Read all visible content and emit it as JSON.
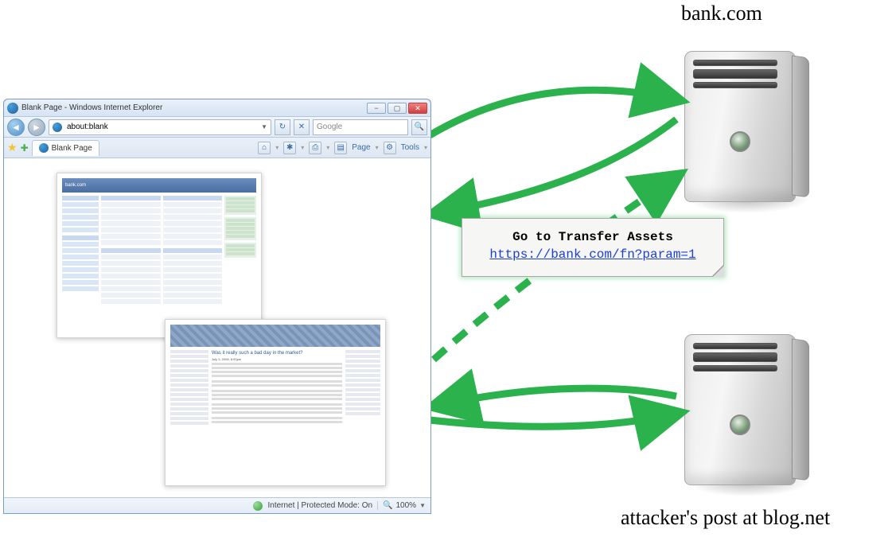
{
  "labels": {
    "bank_server": "bank.com",
    "attacker_server": "attacker's post at blog.net"
  },
  "ie": {
    "title": "Blank Page - Windows Internet Explorer",
    "url": "about:blank",
    "search_placeholder": "Google",
    "tab_name": "Blank Page",
    "toolbar": {
      "page": "Page",
      "tools": "Tools"
    },
    "status": {
      "zone": "Internet | Protected Mode: On",
      "zoom": "100%"
    }
  },
  "thumbs": {
    "bank_header": "bank.com",
    "blog_title_line": "Was it really such a bad day in the market?",
    "blog_date": "July 3, 2008, 8:00pm"
  },
  "note": {
    "line1": "Go to Transfer Assets",
    "url": "https://bank.com/fn?param=1"
  }
}
